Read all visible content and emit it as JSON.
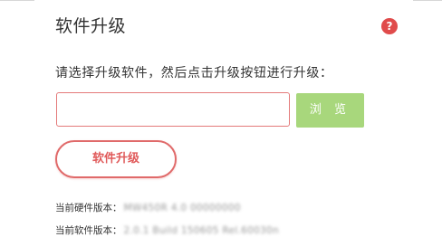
{
  "panel": {
    "title": "软件升级",
    "help_icon": "help-icon",
    "help_symbol": "?"
  },
  "upgrade_form": {
    "instruction": "请选择升级软件，然后点击升级按钮进行升级：",
    "file_input_value": "",
    "browse_label": "浏 览",
    "upgrade_label": "软件升级"
  },
  "device_info": {
    "hardware_label": "当前硬件版本：",
    "hardware_value": "MW450R 4.0 00000000",
    "software_label": "当前软件版本：",
    "software_value": "2.0.1 Build 150605 Rel.60030n"
  },
  "colors": {
    "accent_red": "#e05a5a",
    "browse_green": "#a8d77c",
    "help_icon_red": "#e04b4b"
  }
}
